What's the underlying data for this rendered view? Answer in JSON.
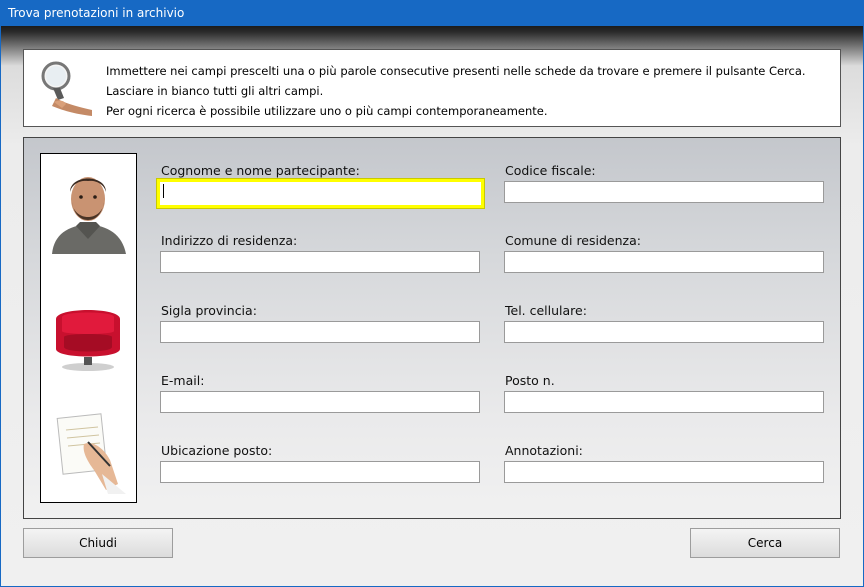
{
  "window": {
    "title": "Trova prenotazioni in archivio"
  },
  "info": {
    "lines": [
      "Immettere nei campi prescelti una o più parole consecutive presenti nelle schede da trovare e premere il pulsante Cerca.",
      "Lasciare in bianco tutti gli altri campi.",
      "Per ogni ricerca è possibile utilizzare uno o più campi contemporaneamente."
    ]
  },
  "fields": {
    "cognome_nome": {
      "label": "Cognome e nome partecipante:",
      "value": ""
    },
    "codice_fiscale": {
      "label": "Codice fiscale:",
      "value": ""
    },
    "indirizzo": {
      "label": "Indirizzo di residenza:",
      "value": ""
    },
    "comune": {
      "label": "Comune di residenza:",
      "value": ""
    },
    "sigla_provincia": {
      "label": "Sigla provincia:",
      "value": ""
    },
    "tel_cellulare": {
      "label": "Tel. cellulare:",
      "value": ""
    },
    "email": {
      "label": "E-mail:",
      "value": ""
    },
    "posto_n": {
      "label": "Posto n.",
      "value": ""
    },
    "ubicazione_posto": {
      "label": "Ubicazione posto:",
      "value": ""
    },
    "annotazioni": {
      "label": "Annotazioni:",
      "value": ""
    }
  },
  "buttons": {
    "close": "Chiudi",
    "search": "Cerca"
  },
  "icons": {
    "info": "magnifier-hand-icon",
    "pic1": "person-photo",
    "pic2": "red-armchair-icon",
    "pic3": "hand-writing-notepad-icon"
  },
  "colors": {
    "titlebar": "#1769c4",
    "focus_border": "#ffff00"
  }
}
